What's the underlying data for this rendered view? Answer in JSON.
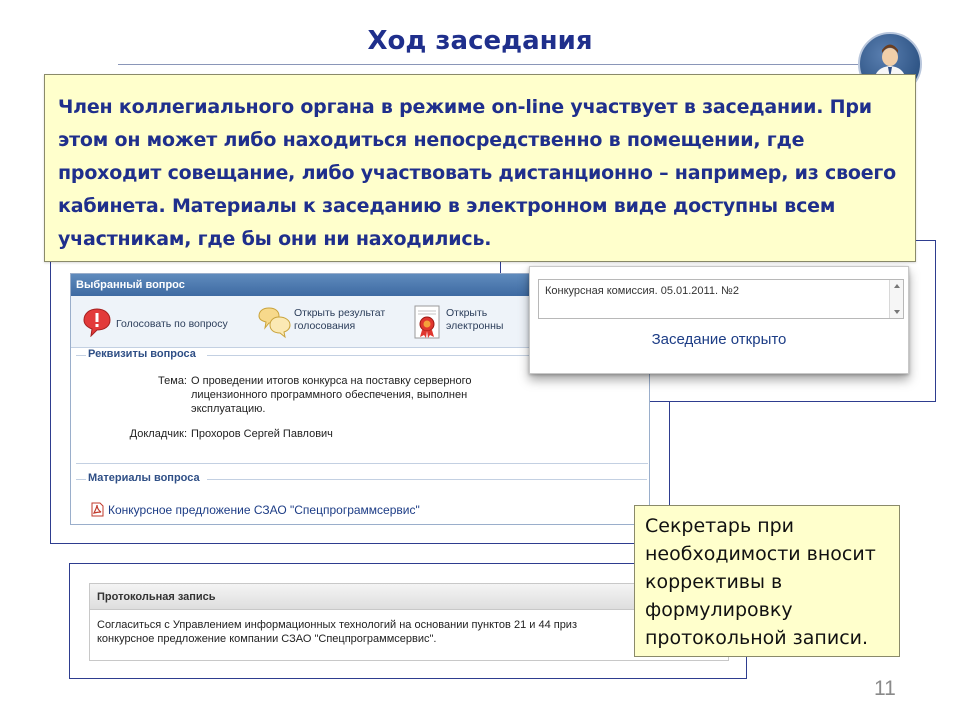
{
  "slide": {
    "title": "Ход заседания",
    "intro": "Член коллегиального органа в режиме on-line участвует в заседании. При этом он может либо находиться непосредственно в помещении, где проходит совещание, либо участвовать дистанционно – например, из своего кабинета. Материалы к заседанию в электронном виде доступны всем участникам, где бы они ни находились.",
    "callout": "Секретарь при необходимости вносит коррективы в формулировку протокольной записи.",
    "page_number": "11"
  },
  "panel": {
    "header": "Выбранный вопрос",
    "toolbar": {
      "vote_label": "Голосовать по вопросу",
      "result_label_1": "Открыть результат",
      "result_label_2": "голосования",
      "doc_label_1": "Открыть",
      "doc_label_2": "электронны"
    },
    "details_title": "Реквизиты вопроса",
    "topic_label": "Тема:",
    "topic_line_1": "О проведении итогов конкурса на поставку серверного",
    "topic_line_2": "лицензионного программного обеспечения, выполнен",
    "topic_line_3": "эксплуатацию.",
    "speaker_label": "Докладчик:",
    "speaker": "Прохоров Сергей Павлович",
    "materials_title": "Материалы вопроса",
    "document": "Конкурсное предложение СЗАО \"Спецпрограммсервис\""
  },
  "popup": {
    "text": "Конкурсная комиссия. 05.01.2011. №2",
    "status": "Заседание открыто"
  },
  "protocol": {
    "header": "Протокольная запись",
    "line_1": "Согласиться с Управлением информационных технологий на основании пунктов 21 и 44 приз",
    "line_2": "конкурсное предложение компании СЗАО \"Спецпрограммсервис\"."
  },
  "colors": {
    "title": "#1f2f8c",
    "callout_background": "#ffffcc",
    "panel_header": "#4a77ad",
    "frame_border": "#2e3d8f"
  },
  "icons": [
    "person-at-desk-icon",
    "vote-speech-bubble-icon",
    "vote-results-icon",
    "certificate-icon",
    "pdf-icon"
  ]
}
